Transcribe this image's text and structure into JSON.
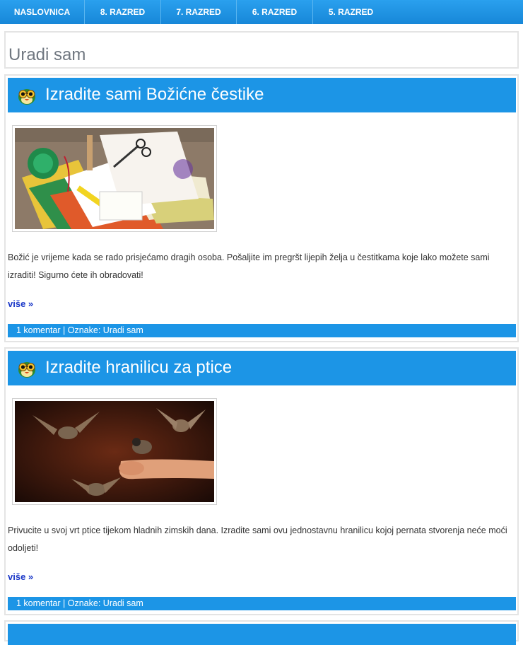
{
  "nav": {
    "items": [
      {
        "label": "NASLOVNICA"
      },
      {
        "label": "8. RAZRED"
      },
      {
        "label": "7. RAZRED"
      },
      {
        "label": "6. RAZRED"
      },
      {
        "label": "5. RAZRED"
      }
    ]
  },
  "page": {
    "title": "Uradi sam"
  },
  "posts": [
    {
      "title": "Izradite sami Božićne čestike",
      "image_icon": "christmas-card-supplies-image",
      "excerpt": "Božić je vrijeme kada se rado prisjećamo dragih osoba. Pošaljite im pregršt lijepih želja u čestitkama koje lako možete sami izraditi! Sigurno ćete ih obradovati!",
      "more": "više »",
      "comments": "1 komentar",
      "sep": "|",
      "tags_label": "Oznake:",
      "tag": "Uradi sam"
    },
    {
      "title": "Izradite hranilicu za ptice",
      "image_icon": "birds-feeding-image",
      "excerpt": "Privucite u svoj vrt ptice tijekom hladnih zimskih dana. Izradite sami ovu jednostavnu hranilicu kojoj pernata stvorenja neće moći odoljeti!",
      "more": "više »",
      "comments": "1 komentar",
      "sep": "|",
      "tags_label": "Oznake:",
      "tag": "Uradi sam"
    }
  ],
  "colors": {
    "accent": "#1c95e6",
    "link": "#1a37c8"
  }
}
